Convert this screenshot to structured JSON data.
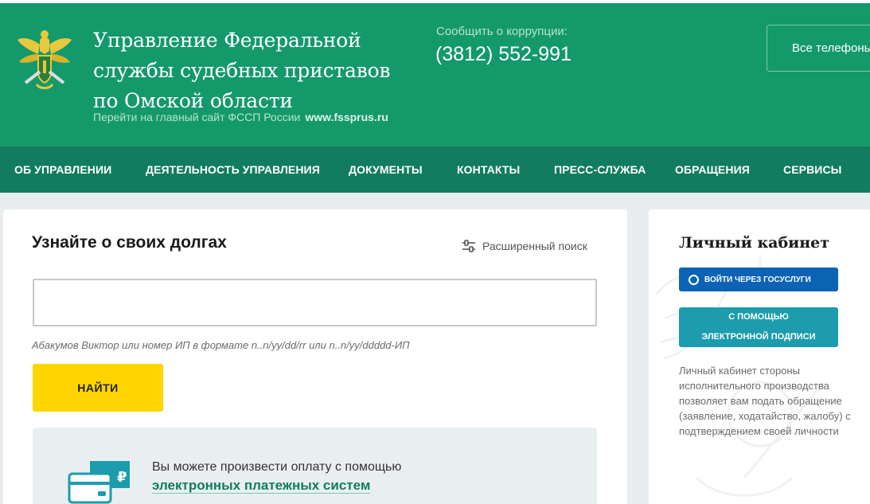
{
  "header": {
    "title_lines": [
      "Управление Федеральной",
      "службы судебных приставов",
      "по Омской области"
    ],
    "main_site_text": "Перейти на главный сайт ФССП России",
    "main_site_url": "www.fssprus.ru",
    "corruption_label": "Сообщить о коррупции:",
    "corruption_phone": "(3812) 552-991",
    "all_phones": "Все телефоны",
    "brand_color": "#14996b"
  },
  "nav": {
    "items": [
      "ОБ УПРАВЛЕНИИ",
      "ДЕЯТЕЛЬНОСТЬ УПРАВЛЕНИЯ",
      "ДОКУМЕНТЫ",
      "КОНТАКТЫ",
      "ПРЕСС-СЛУЖБА",
      "ОБРАЩЕНИЯ",
      "СЕРВИСЫ"
    ],
    "color": "#127c5f"
  },
  "debt_search": {
    "title": "Узнайте о своих долгах",
    "advanced_search": "Расширенный поиск",
    "input_value": "",
    "hint": "Абакумов Виктор или номер ИП в формате n..n/yy/dd/rr или n..n/yy/ddddd-ИП",
    "find_button": "НАЙТИ",
    "button_color": "#ffd500"
  },
  "payment": {
    "text": "Вы можете произвести оплату с помощью",
    "link": "электронных платежных систем",
    "currency_glyph": "₽"
  },
  "cabinet": {
    "title": "Личный кабинет",
    "gosuslugi_button": "ВОЙТИ ЧЕРЕЗ ГОСУСЛУГИ",
    "signature_button_lines": [
      "С ПОМОЩЬЮ",
      "ЭЛЕКТРОННОЙ ПОДПИСИ"
    ],
    "description_lines": [
      "Личный кабинет стороны",
      "исполнительного производства",
      "позволяет вам подать обращение",
      "(заявление, ходатайство, жалобу) с",
      "подтверждением своей личности"
    ]
  }
}
